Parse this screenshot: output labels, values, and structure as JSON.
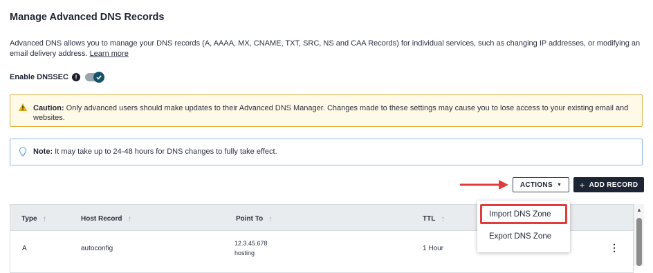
{
  "page": {
    "title": "Manage Advanced DNS Records",
    "description": "Advanced DNS allows you to manage your DNS records (A, AAAA, MX, CNAME, TXT, SRC, NS and CAA Records) for individual services, such as changing IP addresses, or modifying an email delivery address.",
    "learn_more": "Learn more"
  },
  "dnssec": {
    "label": "Enable DNSSEC",
    "info_icon": "!",
    "enabled": true
  },
  "caution": {
    "label": "Caution:",
    "text": "Only advanced users should make updates to their Advanced DNS Manager. Changes made to these settings may cause you to lose access to your existing email and websites."
  },
  "note": {
    "label": "Note:",
    "text": "It may take up to 24-48 hours for DNS changes to fully take effect."
  },
  "toolbar": {
    "actions_label": "ACTIONS",
    "add_record_label": "ADD RECORD"
  },
  "actions_menu": {
    "items": [
      "Import DNS Zone",
      "Export DNS Zone"
    ]
  },
  "table": {
    "headers": [
      "Type",
      "Host Record",
      "Point To",
      "TTL"
    ],
    "rows": [
      {
        "type": "A",
        "host": "autoconfig",
        "point_to": "12.3.45.678",
        "point_to_sub": "hosting",
        "ttl": "1 Hour"
      }
    ]
  },
  "colors": {
    "primary_dark": "#1d2433",
    "caution_border": "#e0b243",
    "note_border": "#8fb6dd",
    "highlight_red": "#e13b3b",
    "toggle_on": "#14546b"
  }
}
